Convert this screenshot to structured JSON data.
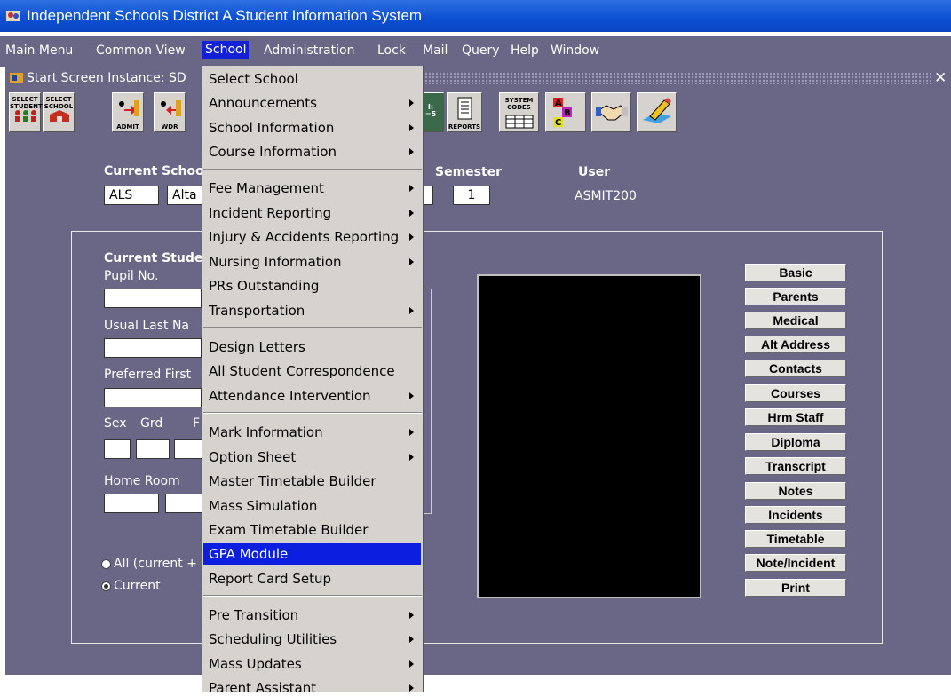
{
  "window": {
    "title": "Independent Schools District A Student Information System",
    "inner_title": "Start Screen  Instance: SD"
  },
  "menubar": [
    {
      "label": "Main Menu"
    },
    {
      "label": "Common View"
    },
    {
      "label": "School"
    },
    {
      "label": "Administration"
    },
    {
      "label": "Lock"
    },
    {
      "label": "Mail"
    },
    {
      "label": "Query"
    },
    {
      "label": "Help"
    },
    {
      "label": "Window"
    }
  ],
  "toolbar": {
    "select_student": "SELECT\nSTUDENT",
    "select_school": "SELECT\nSCHOOL",
    "admit": "ADMIT",
    "wdr": "WDR",
    "reports": "REPORTS",
    "system_codes": "SYSTEM\nCODES"
  },
  "header": {
    "current_school_label": "Current School",
    "school_code": "ALS",
    "school_name": "Alta",
    "semester_label": "Semester",
    "semester_value": "1",
    "user_label": "User",
    "user_value": "ASMIT200"
  },
  "student": {
    "current_student_label": "Current Studen",
    "pupil_no_label": "Pupil No.",
    "usual_last_name_label": "Usual Last Na",
    "preferred_first_label": "Preferred First",
    "sex_label": "Sex",
    "grd_label": "Grd",
    "f_label": "F",
    "home_room_label": "Home Room",
    "radio_all_label": "All (current +",
    "radio_current_label": "Current"
  },
  "side_buttons": [
    "Basic",
    "Parents",
    "Medical",
    "Alt Address",
    "Contacts",
    "Courses",
    "Hrm Staff",
    "Diploma",
    "Transcript",
    "Notes",
    "Incidents",
    "Timetable",
    "Note/Incident",
    "Print"
  ],
  "school_menu": [
    {
      "label": "Select School"
    },
    {
      "label": "Announcements"
    },
    {
      "label": "School Information"
    },
    {
      "label": "Course Information"
    },
    {
      "label": "Fee Management"
    },
    {
      "label": "Incident Reporting"
    },
    {
      "label": "Injury & Accidents Reporting"
    },
    {
      "label": "Nursing Information"
    },
    {
      "label": "PRs Outstanding"
    },
    {
      "label": "Transportation"
    },
    {
      "label": "Design Letters"
    },
    {
      "label": "All Student Correspondence"
    },
    {
      "label": "Attendance Intervention"
    },
    {
      "label": "Mark Information"
    },
    {
      "label": "Option Sheet"
    },
    {
      "label": "Master Timetable Builder"
    },
    {
      "label": "Mass Simulation"
    },
    {
      "label": "Exam Timetable Builder"
    },
    {
      "label": "GPA Module"
    },
    {
      "label": "Report Card Setup"
    },
    {
      "label": "Pre Transition"
    },
    {
      "label": "Scheduling Utilities"
    },
    {
      "label": "Mass Updates"
    },
    {
      "label": "Parent Assistant"
    }
  ],
  "colors": {
    "menu_highlight": "#1221d6",
    "titlebar": "#0b4fd2",
    "window_bg": "#6a6786"
  }
}
